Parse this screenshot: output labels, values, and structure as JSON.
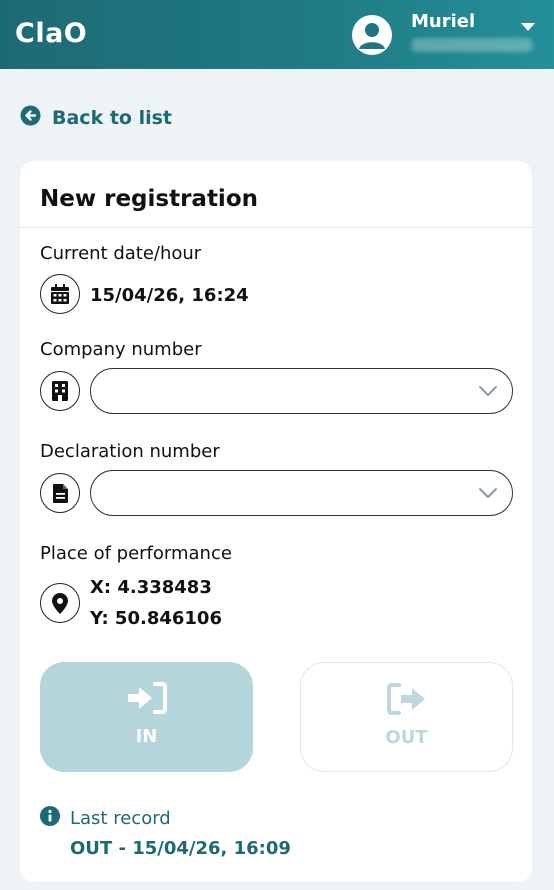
{
  "header": {
    "app_name": "ClaO",
    "user": {
      "name": "Muriel"
    }
  },
  "nav": {
    "back_label": "Back to list"
  },
  "form": {
    "title": "New registration",
    "date": {
      "label": "Current date/hour",
      "value": "15/04/26, 16:24"
    },
    "company": {
      "label": "Company number",
      "value": ""
    },
    "declaration": {
      "label": "Declaration number",
      "value": ""
    },
    "place": {
      "label": "Place of performance",
      "x": "X: 4.338483",
      "y": "Y: 50.846106"
    }
  },
  "actions": {
    "in_label": "IN",
    "out_label": "OUT"
  },
  "last_record": {
    "label": "Last record",
    "value": "OUT - 15/04/26, 16:09"
  },
  "colors": {
    "brand": "#1d6a74",
    "in_button": "#b4d5da",
    "out_disabled": "#bcd8dc"
  },
  "icons": {
    "avatar": "user-circle-icon",
    "caret": "caret-down-icon",
    "back": "arrow-circle-left-icon",
    "date": "calendar-icon",
    "company": "building-icon",
    "declaration": "document-icon",
    "place": "map-pin-icon",
    "in": "sign-in-icon",
    "out": "sign-out-icon",
    "info": "info-circle-icon"
  }
}
